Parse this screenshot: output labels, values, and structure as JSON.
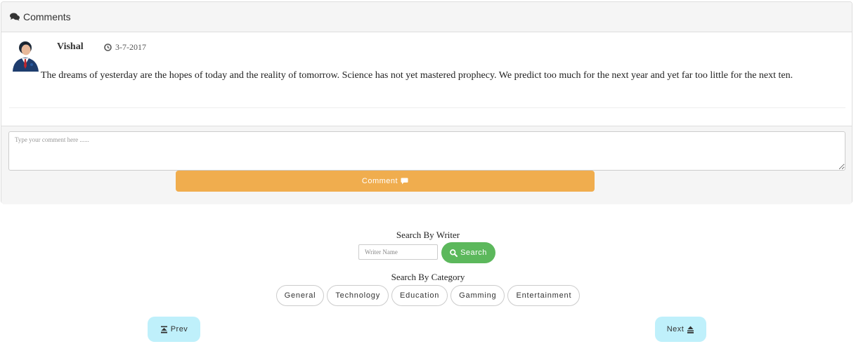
{
  "panel": {
    "heading": "Comments",
    "comment": {
      "author": "Vishal",
      "date": "3-7-2017",
      "text": "The dreams of yesterday are the hopes of today and the reality of tomorrow. Science has not yet mastered prophecy. We predict too much for the next year and yet far too little for the next ten."
    },
    "form": {
      "placeholder": "Type your comment here ......",
      "button_label": "Comment"
    }
  },
  "search_writer": {
    "title": "Search By Writer",
    "placeholder": "Writer Name",
    "button_label": "Search"
  },
  "search_category": {
    "title": "Search By Category",
    "categories": [
      "General",
      "Technology",
      "Education",
      "Gamming",
      "Entertainment"
    ]
  },
  "pagination": {
    "prev_label": "Prev",
    "next_label": "Next"
  },
  "colors": {
    "comment_button": "#f0ad4e",
    "search_button": "#5cb85c",
    "nav_button": "#bff0fb"
  }
}
